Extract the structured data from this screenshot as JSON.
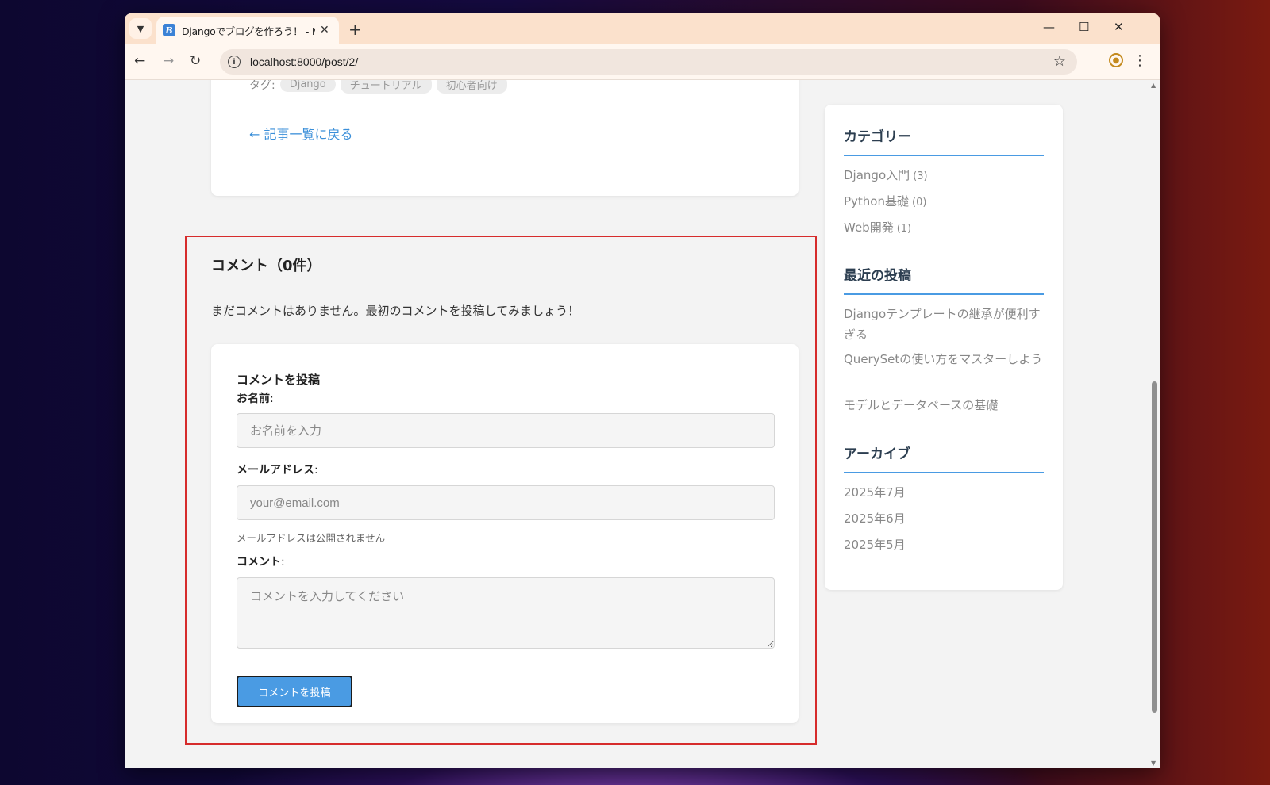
{
  "browser": {
    "tab_title": "Djangoでブログを作ろう！ - My Bl",
    "favicon_letter": "B",
    "url": "localhost:8000/post/2/"
  },
  "post": {
    "tags_label": "タグ:",
    "tags": [
      "Django",
      "チュートリアル",
      "初心者向け"
    ],
    "back_link": "← 記事一覧に戻る"
  },
  "comments": {
    "heading": "コメント（0件）",
    "empty_message": "まだコメントはありません。最初のコメントを投稿してみましょう！",
    "form": {
      "title": "コメントを投稿",
      "name_label": "お名前",
      "name_placeholder": "お名前を入力",
      "email_label": "メールアドレス",
      "email_placeholder": "your@email.com",
      "email_help": "メールアドレスは公開されません",
      "comment_label": "コメント",
      "comment_placeholder": "コメントを入力してください",
      "submit_label": "コメントを投稿",
      "colon": ":"
    }
  },
  "sidebar": {
    "categories_title": "カテゴリー",
    "categories": [
      {
        "name": "Django入門",
        "count": "(3)"
      },
      {
        "name": "Python基礎",
        "count": "(0)"
      },
      {
        "name": "Web開発",
        "count": "(1)"
      }
    ],
    "recent_title": "最近の投稿",
    "recent": [
      "Djangoテンプレートの継承が便利すぎる",
      "QuerySetの使い方をマスターしよう",
      "モデルとデータベースの基礎"
    ],
    "archive_title": "アーカイブ",
    "archives": [
      "2025年7月",
      "2025年6月",
      "2025年5月"
    ]
  },
  "colors": {
    "accent": "#4a9be3",
    "highlight_border": "#d62b2b",
    "link": "#3b8fd9"
  }
}
